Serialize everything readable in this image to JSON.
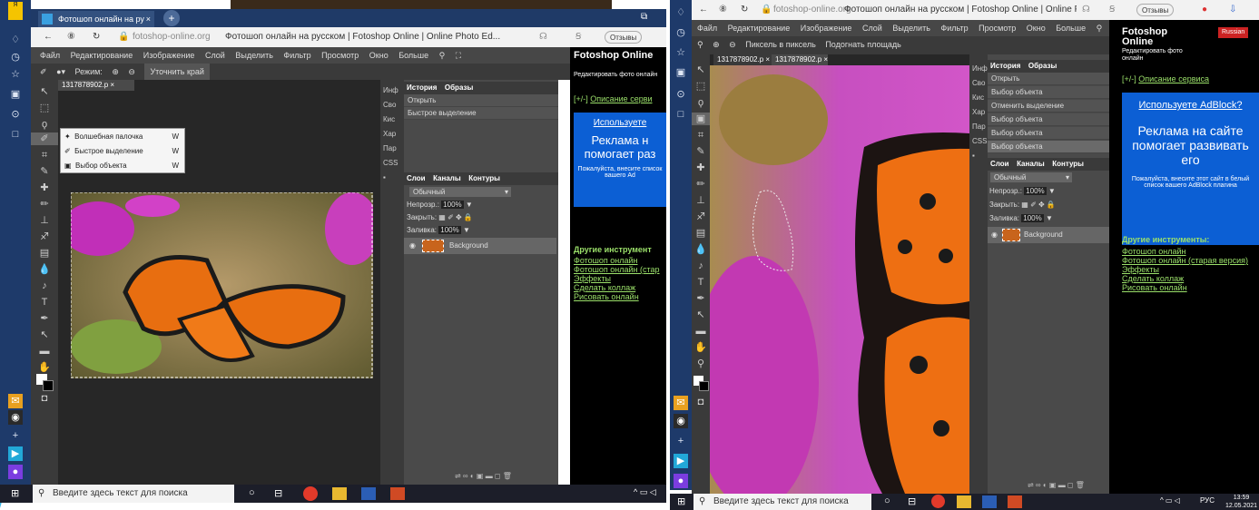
{
  "left": {
    "browser_tab": "Фотошоп онлайн на ру",
    "address_domain": "fotoshop-online.org",
    "page_title": "Фотошоп онлайн на русском | Fotoshop Online | Online Photo Ed...",
    "feedback": "Отзывы",
    "menu": [
      "Файл",
      "Редактирование",
      "Изображение",
      "Слой",
      "Выделить",
      "Фильтр",
      "Просмотр",
      "Окно",
      "Больше"
    ],
    "options": {
      "mode_label": "Режим:",
      "refine": "Уточнить край"
    },
    "doc_tab": "1317878902.p",
    "flyout": [
      {
        "label": "Волшебная палочка",
        "key": "W"
      },
      {
        "label": "Быстрое выделение",
        "key": "W"
      },
      {
        "label": "Выбор объекта",
        "key": "W"
      }
    ],
    "side_labels": [
      "Инф",
      "Сво",
      "Кис",
      "Хар",
      "Пар",
      "CSS"
    ],
    "history_tabs": [
      "История",
      "Образы"
    ],
    "history": [
      "Открыть",
      "Быстрое выделение"
    ],
    "layer_tabs": [
      "Слои",
      "Каналы",
      "Контуры"
    ],
    "blend": "Обычный",
    "opacity_label": "Непрозр.:",
    "opacity": "100%",
    "lock_label": "Закрыть:",
    "fill_label": "Заливка:",
    "fill": "100%",
    "layer_name": "Background",
    "ad": {
      "title": "Fotoshop Online",
      "subtitle": "Редактировать фото онлайн",
      "toggle": "[+/-]",
      "desc_link": "Описание серви",
      "adblock": "Используете",
      "headline": "Реклама н помогает раз",
      "small": "Пожалуйста, внесите список вашего Ad",
      "other_title": "Другие инструмент",
      "links": [
        "Фотошоп онлайн",
        "Фотошоп онлайн (стар",
        "Эффекты",
        "Сделать коллаж",
        "Рисовать онлайн"
      ]
    },
    "taskbar_search": "Введите здесь текст для поиска"
  },
  "right": {
    "address_domain": "fotoshop-online.org",
    "page_title": "Фотошоп онлайн на русском | Fotoshop Online | Online Photo Edi...",
    "feedback": "Отзывы",
    "menu": [
      "Файл",
      "Редактирование",
      "Изображение",
      "Слой",
      "Выделить",
      "Фильтр",
      "Просмотр",
      "Окно",
      "Больше"
    ],
    "options": {
      "pixel": "Пиксель в пиксель",
      "fit": "Подогнать площадь"
    },
    "doc_tabs": [
      "1317878902.p",
      "1317878902.p"
    ],
    "side_labels": [
      "Инф",
      "Сво",
      "Кис",
      "Хар",
      "Пар",
      "CSS"
    ],
    "history_tabs": [
      "История",
      "Образы"
    ],
    "history": [
      "Открыть",
      "Выбор объекта",
      "Отменить выделение",
      "Выбор объекта",
      "Выбор объекта",
      "Выбор объекта"
    ],
    "layer_tabs": [
      "Слои",
      "Каналы",
      "Контуры"
    ],
    "blend": "Обычный",
    "opacity_label": "Непрозр.:",
    "opacity": "100%",
    "lock_label": "Закрыть:",
    "fill_label": "Заливка:",
    "fill": "100%",
    "layer_name": "Background",
    "ad": {
      "title": "Fotoshop Online",
      "subtitle": "Редактировать фото онлайн",
      "lang": "Russian",
      "toggle": "[+/-]",
      "desc_link": "Описание сервиса",
      "adblock": "Используете AdBlock?",
      "headline": "Реклама на сайте помогает развивать его",
      "small": "Пожалуйста, внесите этот сайт в белый список вашего AdBlock плагина",
      "other_title": "Другие инструменты:",
      "links": [
        "Фотошоп онлайн",
        "Фотошоп онлайн (старая версия)",
        "Эффекты",
        "Сделать коллаж",
        "Рисовать онлайн"
      ]
    },
    "taskbar_search": "Введите здесь текст для поиска",
    "tray_lang": "РУС",
    "time": "13:59",
    "date": "12.05.2021"
  },
  "colors": {
    "dark": "#272727",
    "panel": "#4a4a4a",
    "ad_blue": "#0c5fd4",
    "tab_blue": "#1f3a67",
    "link_green": "#9be06a"
  }
}
